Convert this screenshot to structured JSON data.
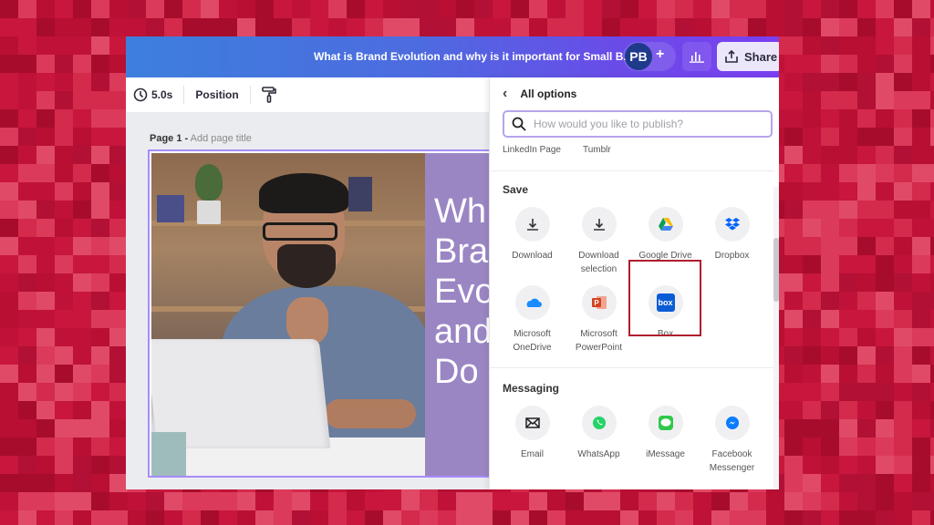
{
  "header": {
    "doc_title": "What is Brand Evolution and why is it important for Small B...",
    "avatar_initials": "PB",
    "add_collaborator_label": "+",
    "share_label": "Share"
  },
  "toolbar": {
    "duration": "5.0s",
    "position_label": "Position"
  },
  "canvas": {
    "page_label": "Page 1 -",
    "page_title_placeholder": "Add page title",
    "headline_lines": [
      "Wh",
      "Bra",
      "Evo",
      "and",
      "Do"
    ]
  },
  "publish_panel": {
    "back_label": "All options",
    "search_placeholder": "How would you like to publish?",
    "previous_row": [
      "LinkedIn Page",
      "Tumblr"
    ],
    "sections": [
      {
        "title": "Save",
        "items": [
          {
            "label": "Download",
            "icon": "download-icon"
          },
          {
            "label": "Download selection",
            "icon": "download-icon"
          },
          {
            "label": "Google Drive",
            "icon": "google-drive-icon",
            "highlighted": true
          },
          {
            "label": "Dropbox",
            "icon": "dropbox-icon"
          },
          {
            "label": "Microsoft OneDrive",
            "icon": "onedrive-icon"
          },
          {
            "label": "Microsoft PowerPoint",
            "icon": "powerpoint-icon"
          },
          {
            "label": "Box",
            "icon": "box-icon"
          }
        ]
      },
      {
        "title": "Messaging",
        "items": [
          {
            "label": "Email",
            "icon": "email-icon"
          },
          {
            "label": "WhatsApp",
            "icon": "whatsapp-icon"
          },
          {
            "label": "iMessage",
            "icon": "imessage-icon"
          },
          {
            "label": "Facebook Messenger",
            "icon": "messenger-icon"
          }
        ]
      }
    ],
    "box_icon_text": "box"
  },
  "colors": {
    "background": "#c8143c",
    "header_gradient_start": "#3d7fdc",
    "header_gradient_end": "#7a3ff0",
    "highlight_border": "#b01c2e",
    "text_panel": "#9b86c4"
  }
}
